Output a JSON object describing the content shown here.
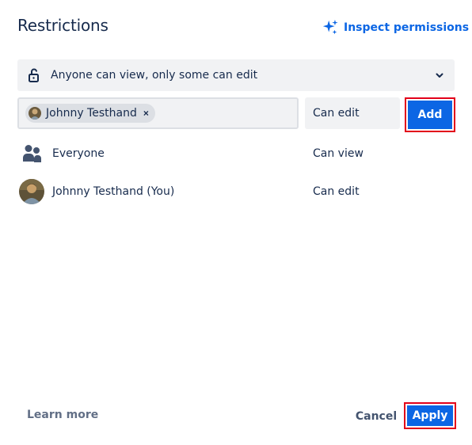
{
  "dialog": {
    "title": "Restrictions",
    "inspect_label": "Inspect permissions"
  },
  "restriction_select": {
    "value": "Anyone can view, only some can edit"
  },
  "people_input": {
    "chips": [
      {
        "label": "Johnny Testhand"
      }
    ]
  },
  "permission_select": {
    "value": "Can edit"
  },
  "add_label": "Add",
  "rows": [
    {
      "name": "Everyone",
      "permission": "Can view",
      "icon": "people-group-icon"
    },
    {
      "name": "Johnny Testhand (You)",
      "permission": "Can edit",
      "icon": "avatar"
    }
  ],
  "footer": {
    "learn_more": "Learn more",
    "cancel": "Cancel",
    "apply": "Apply"
  },
  "colors": {
    "primary": "#0C66E4",
    "highlight": "#E2001A",
    "text": "#172B4D",
    "subtle": "#F1F2F4"
  }
}
